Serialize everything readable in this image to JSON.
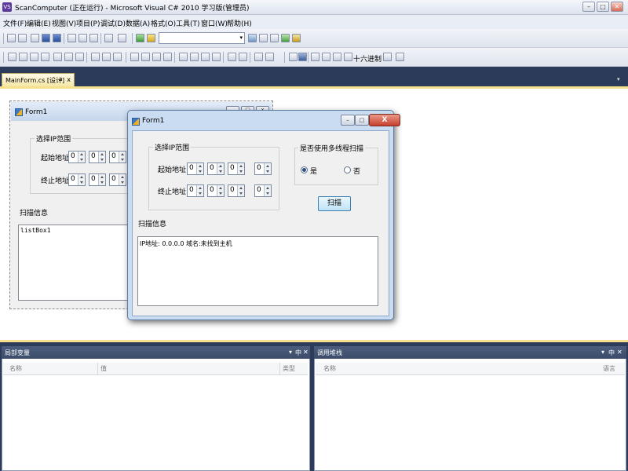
{
  "window": {
    "title": "ScanComputer (正在运行) - Microsoft Visual C# 2010 学习版(管理员)",
    "app_icon": "visual-studio-icon",
    "controls": {
      "minimize": "–",
      "maximize": "□",
      "close": "✕"
    }
  },
  "menu": [
    "文件(F)",
    "编辑(E)",
    "视图(V)",
    "项目(P)",
    "调试(D)",
    "数据(A)",
    "格式(O)",
    "工具(T)",
    "窗口(W)",
    "帮助(H)"
  ],
  "toolbar": {
    "config_value": "",
    "hex_label": "十六进制"
  },
  "doc_tab": {
    "label": "MainForm.cs [设计]",
    "pin": "⊿",
    "close": "x"
  },
  "design_form": {
    "title": "Form1",
    "group_title": "选择IP范围",
    "start_label": "起始地址:",
    "end_label": "终止地址:",
    "start_values": [
      "0",
      "0",
      "0"
    ],
    "end_values": [
      "0",
      "0",
      "0"
    ],
    "info_label": "扫描信息",
    "listbox_text": "listBox1"
  },
  "run_form": {
    "title": "Form1",
    "group_title": "选择IP范围",
    "start_label": "起始地址:",
    "end_label": "终止地址:",
    "start_values": [
      "0",
      "0",
      "0",
      "0"
    ],
    "end_values": [
      "0",
      "0",
      "0",
      "0"
    ],
    "thread_group_title": "是否使用多线程扫描",
    "radio_yes": "是",
    "radio_no": "否",
    "radio_selected": "是",
    "scan_button": "扫描",
    "info_label": "扫描信息",
    "result_text": "IP地址: 0.0.0.0 域名:未找到主机",
    "close": "X"
  },
  "locals_pane": {
    "title": "局部变量",
    "columns": [
      "名称",
      "值",
      "类型"
    ],
    "controls": {
      "menu": "▾",
      "pin": "中",
      "close": "✕"
    }
  },
  "callstack_pane": {
    "title": "调用堆栈",
    "columns": [
      "名称",
      "语言"
    ],
    "controls": {
      "menu": "▾",
      "pin": "中",
      "close": "✕"
    }
  },
  "colors": {
    "ide_background": "#2c3b5a",
    "tab_active": "#f5e7a7",
    "designer_border": "#f6e08d",
    "form_caption": "#c9dcf1",
    "close_button": "#c7402c"
  }
}
